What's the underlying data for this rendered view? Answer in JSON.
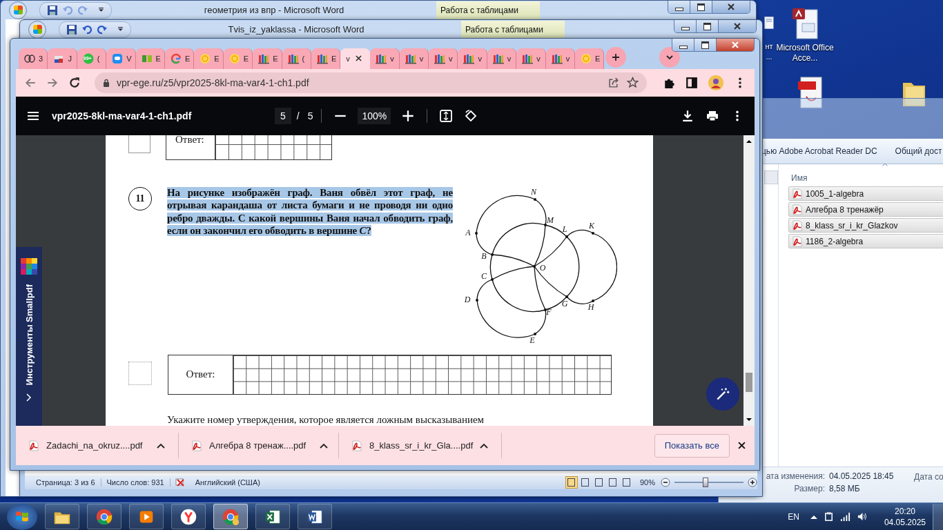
{
  "word_windows": [
    {
      "title": "геометрия из впр - Microsoft Word",
      "context_tab": "Работа с таблицами"
    },
    {
      "title": "Tvis_iz_yaklassa - Microsoft Word",
      "context_tab": "Работа с таблицами"
    }
  ],
  "word_status_bar": {
    "page": "Страница: 3 из 6",
    "words": "Число слов: 931",
    "language": "Английский (США)",
    "zoom": "90%",
    "level": 0.45
  },
  "desktop_icons": [
    {
      "kind": "document",
      "label": "нт ..."
    },
    {
      "kind": "access",
      "label": "Microsoft Office Acce..."
    },
    {
      "kind": "pdf"
    },
    {
      "kind": "folder"
    }
  ],
  "browser": {
    "tabs": [
      {
        "kind": "butterfly",
        "text": "3",
        "selected": false
      },
      {
        "kind": "box",
        "text": "J",
        "selected": false
      },
      {
        "kind": "chat-badge",
        "badge": "99+",
        "text": "(",
        "selected": false
      },
      {
        "kind": "chat",
        "text": "V",
        "selected": false
      },
      {
        "kind": "book",
        "text": "E",
        "selected": false
      },
      {
        "kind": "google",
        "text": "E",
        "selected": false
      },
      {
        "kind": "sun",
        "text": "E",
        "selected": false
      },
      {
        "kind": "sun",
        "text": "E",
        "selected": false
      },
      {
        "kind": "books",
        "text": "E",
        "selected": false
      },
      {
        "kind": "books",
        "text": "(",
        "selected": false
      },
      {
        "kind": "books",
        "text": "E",
        "selected": false
      },
      {
        "kind": "plain",
        "text": "v",
        "selected": true
      },
      {
        "kind": "books",
        "text": "v",
        "selected": false
      },
      {
        "kind": "books",
        "text": "v",
        "selected": false
      },
      {
        "kind": "books",
        "text": "v",
        "selected": false
      },
      {
        "kind": "books",
        "text": "v",
        "selected": false
      },
      {
        "kind": "books",
        "text": "v",
        "selected": false
      },
      {
        "kind": "books",
        "text": "v",
        "selected": false
      },
      {
        "kind": "books",
        "text": "v",
        "selected": false
      },
      {
        "kind": "sun",
        "text": "E",
        "selected": false
      }
    ],
    "address": "vpr-ege.ru/z5/vpr2025-8kl-ma-var4-1-ch1.pdf",
    "pdf": {
      "file": "vpr2025-8kl-ma-var4-1-ch1.pdf",
      "page": "5",
      "separator": "/",
      "pages": "5",
      "zoom": "100%"
    },
    "document": {
      "top_answer_label": "Ответ:",
      "question_number": "11",
      "question": "На рисунке изображён граф. Ваня обвёл этот граф, не отрывая карандаша от листа бумаги и не проводя ни одно ребро дважды. С какой вершины Ваня начал обводить граф, если он закончил его обводить в вершине *C*?",
      "highlighted": true,
      "vertices": [
        {
          "label": "N"
        },
        {
          "label": "M"
        },
        {
          "label": "L"
        },
        {
          "label": "K"
        },
        {
          "label": "A"
        },
        {
          "label": "B"
        },
        {
          "label": "O"
        },
        {
          "label": "C"
        },
        {
          "label": "D"
        },
        {
          "label": "G"
        },
        {
          "label": "H"
        },
        {
          "label": "F"
        },
        {
          "label": "E"
        }
      ],
      "answer_label": "Ответ:",
      "next_question": "Укажите номер утверждения, которое является ложным высказыванием"
    },
    "side_panel": {
      "title": "Инструменты Smallpdf"
    },
    "downloads": [
      {
        "name": "Zadachi_na_okruz....pdf"
      },
      {
        "name": "Алгебра 8 тренаж....pdf"
      },
      {
        "name": "8_klass_sr_i_kr_Gla....pdf"
      }
    ],
    "show_all": "Показать все"
  },
  "explorer": {
    "toolbar": [
      "цью Adobe Acrobat Reader DC",
      "Общий дост"
    ],
    "column": "Имя",
    "files": [
      {
        "name": "1005_1-algebra",
        "selected": true
      },
      {
        "name": "Алгебра 8 тренажёр",
        "selected": true
      },
      {
        "name": "8_klass_sr_i_kr_Glazkov",
        "selected": true
      },
      {
        "name": "1186_2-algebra",
        "selected": true
      }
    ],
    "details": [
      {
        "label": "ата изменения:",
        "value": "04.05.2025 18:45"
      },
      {
        "label": "Размер:",
        "value": "8,58 МБ"
      }
    ],
    "details_extra": "Дата со"
  },
  "taskbar": {
    "apps": [
      {
        "kind": "folder",
        "selected": false
      },
      {
        "kind": "chrome",
        "selected": false
      },
      {
        "kind": "media",
        "selected": false
      },
      {
        "kind": "yandex",
        "selected": false
      },
      {
        "kind": "chrome-profile",
        "selected": true
      },
      {
        "kind": "excel",
        "selected": false
      },
      {
        "kind": "word",
        "selected": false
      }
    ],
    "language": "EN",
    "time": "20:20",
    "date": "04.05.2025"
  }
}
